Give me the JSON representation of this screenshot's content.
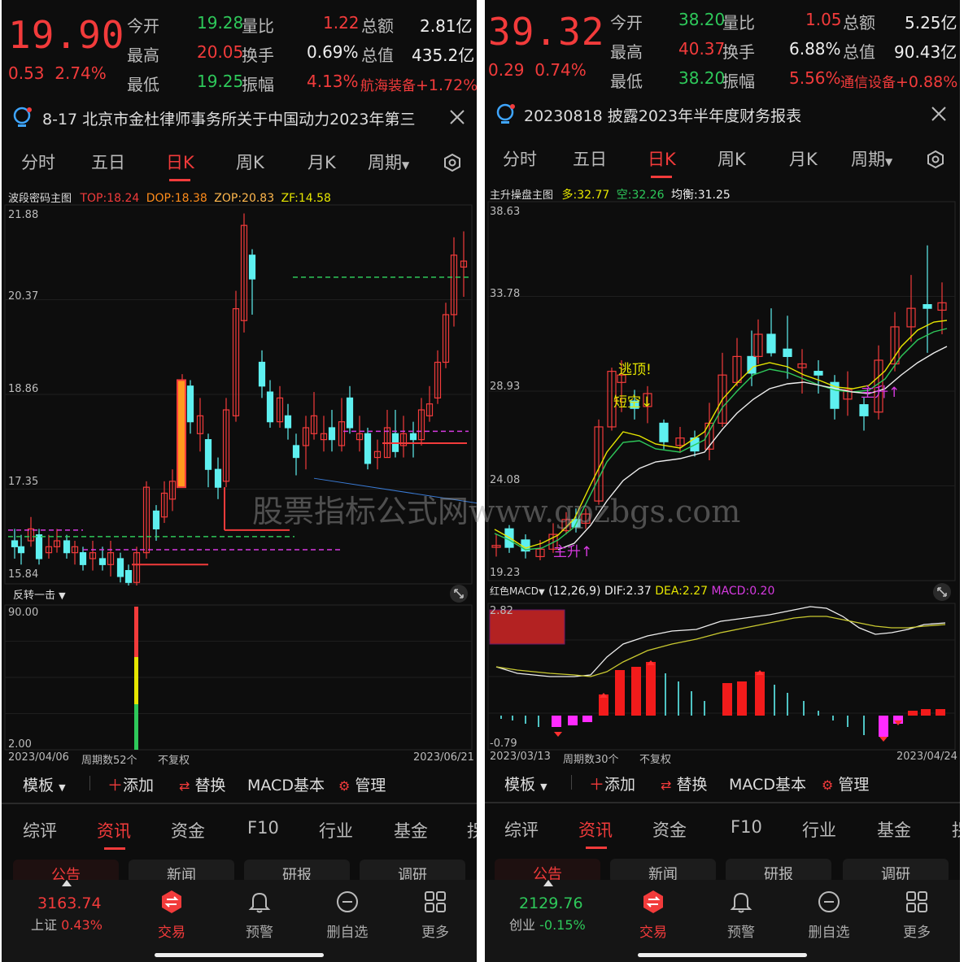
{
  "watermark": "股票指标公式网www.gpzbgs.com",
  "panels": [
    {
      "price": "19.90",
      "chg": "0.53",
      "pct": "2.74%",
      "kv": [
        {
          "k": "今开",
          "v": "19.28",
          "c": "green"
        },
        {
          "k": "量比",
          "v": "1.22",
          "c": "red"
        },
        {
          "k": "总额",
          "v": "2.81亿",
          "c": "white"
        },
        {
          "k": "最高",
          "v": "20.05",
          "c": "red"
        },
        {
          "k": "换手",
          "v": "0.69%",
          "c": "white"
        },
        {
          "k": "总值",
          "v": "435.2亿",
          "c": "white"
        },
        {
          "k": "最低",
          "v": "19.25",
          "c": "green"
        },
        {
          "k": "振幅",
          "v": "4.13%",
          "c": "red"
        }
      ],
      "sector": "航海装备",
      "sector_pct": "+1.72%",
      "notice": "8-17 北京市金杜律师事务所关于中国动力2023年第三",
      "tabs": [
        "分时",
        "五日",
        "日K",
        "周K",
        "月K",
        "周期"
      ],
      "active_tab": 2,
      "indicator": {
        "name": "波段密码主图",
        "items": [
          {
            "k": "TOP:",
            "v": "18.24",
            "c": "#f23b3b"
          },
          {
            "k": "DOP:",
            "v": "18.38",
            "c": "#ff8c1a"
          },
          {
            "k": "ZOP:",
            "v": "20.83",
            "c": "#ffb84d"
          },
          {
            "k": "ZF:",
            "v": "14.58",
            "c": "#e6e600"
          }
        ]
      },
      "yticks": [
        "21.88",
        "20.37",
        "18.86",
        "17.35",
        "15.84"
      ],
      "sub_name": "反转一击",
      "sub_top": "90.00",
      "sub_bottom": "2.00",
      "date_start": "2023/04/06",
      "period_count": "周期数52个",
      "adjust": "不复权",
      "date_end": "2023/06/21",
      "toolbar": {
        "template": "模板",
        "add": "添加",
        "replace": "替换",
        "macd": "MACD基本",
        "manage": "管理"
      },
      "bottom_tabs": [
        "综评",
        "资讯",
        "资金",
        "F10",
        "行业",
        "基金",
        "拐"
      ],
      "chips": [
        "公告",
        "新闻",
        "研报",
        "调研"
      ],
      "index": {
        "value": "3163.74",
        "name": "上证",
        "pct": "0.43%",
        "color": "#f23b3b"
      },
      "nav": [
        "交易",
        "预警",
        "删自选",
        "更多"
      ]
    },
    {
      "price": "39.32",
      "chg": "0.29",
      "pct": "0.74%",
      "kv": [
        {
          "k": "今开",
          "v": "38.20",
          "c": "green"
        },
        {
          "k": "量比",
          "v": "1.05",
          "c": "red"
        },
        {
          "k": "总额",
          "v": "5.25亿",
          "c": "white"
        },
        {
          "k": "最高",
          "v": "40.37",
          "c": "red"
        },
        {
          "k": "换手",
          "v": "6.88%",
          "c": "white"
        },
        {
          "k": "总值",
          "v": "90.43亿",
          "c": "white"
        },
        {
          "k": "最低",
          "v": "38.20",
          "c": "green"
        },
        {
          "k": "振幅",
          "v": "5.56%",
          "c": "red"
        }
      ],
      "sector": "通信设备",
      "sector_pct": "+0.88%",
      "notice": "20230818 披露2023年半年度财务报表",
      "tabs": [
        "分时",
        "五日",
        "日K",
        "周K",
        "月K",
        "周期"
      ],
      "active_tab": 2,
      "indicator": {
        "name": "主升操盘主图",
        "items": [
          {
            "k": "多:",
            "v": "32.77",
            "c": "#e6e600"
          },
          {
            "k": "空:",
            "v": "32.26",
            "c": "#2ec85a"
          },
          {
            "k": "均衡:",
            "v": "31.25",
            "c": "#eeeeee"
          }
        ]
      },
      "yticks": [
        "38.63",
        "33.78",
        "28.93",
        "24.08",
        "19.23"
      ],
      "labels": {
        "escape": "逃顶!",
        "short": "短空↓",
        "rise": "主升↑"
      },
      "sub_name": "红色MACD",
      "macd": {
        "params": "(12,26,9)",
        "dif": "2.37",
        "dea": "2.27",
        "macd": "0.20"
      },
      "sub_top": "2.82",
      "sub_bottom": "-0.79",
      "date_start": "2023/03/13",
      "period_count": "周期数30个",
      "adjust": "不复权",
      "date_end": "2023/04/24",
      "toolbar": {
        "template": "模板",
        "add": "添加",
        "replace": "替换",
        "macd": "MACD基本",
        "manage": "管理"
      },
      "bottom_tabs": [
        "综评",
        "资讯",
        "资金",
        "F10",
        "行业",
        "基金",
        "拐"
      ],
      "chips": [
        "公告",
        "新闻",
        "研报",
        "调研"
      ],
      "index": {
        "value": "2129.76",
        "name": "创业",
        "pct": "-0.15%",
        "color": "#2ec85a"
      },
      "nav": [
        "交易",
        "预警",
        "删自选",
        "更多"
      ]
    }
  ]
}
